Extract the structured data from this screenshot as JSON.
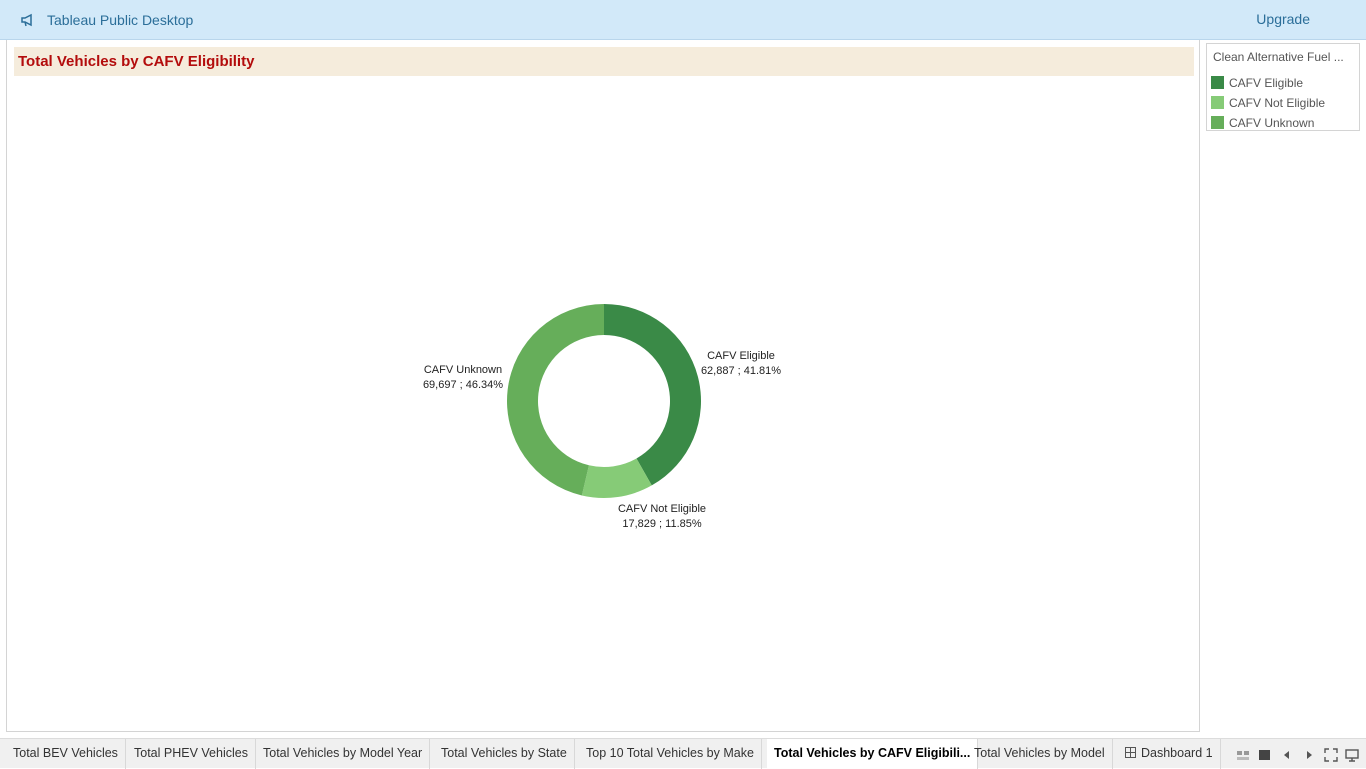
{
  "app": {
    "title": "Tableau Public Desktop",
    "upgrade_label": "Upgrade"
  },
  "sheet": {
    "title": "Total Vehicles by CAFV Eligibility"
  },
  "legend": {
    "title": "Clean Alternative Fuel ...",
    "items": [
      {
        "label": "CAFV Eligible",
        "color": "#3a8a47"
      },
      {
        "label": "CAFV Not Eligible",
        "color": "#86cb77"
      },
      {
        "label": "CAFV Unknown",
        "color": "#66ae5a"
      }
    ]
  },
  "chart_data": {
    "type": "pie",
    "title": "Total Vehicles by CAFV Eligibility",
    "slices": [
      {
        "category": "CAFV Eligible",
        "value": 62887,
        "percent": 41.81,
        "label": "62,887 ; 41.81%",
        "color": "#3a8a47"
      },
      {
        "category": "CAFV Not Eligible",
        "value": 17829,
        "percent": 11.85,
        "label": "17,829 ; 11.85%",
        "color": "#86cb77"
      },
      {
        "category": "CAFV Unknown",
        "value": 69697,
        "percent": 46.34,
        "label": "69,697 ; 46.34%",
        "color": "#66ae5a"
      }
    ]
  },
  "tabs": [
    {
      "label": "Total BEV Vehicles",
      "active": false
    },
    {
      "label": "Total PHEV Vehicles",
      "active": false
    },
    {
      "label": "Total Vehicles by Model Year",
      "active": false
    },
    {
      "label": "Total Vehicles by State",
      "active": false
    },
    {
      "label": "Top 10 Total Vehicles by Make",
      "active": false
    },
    {
      "label": "Total Vehicles by CAFV Eligibili...",
      "active": true
    },
    {
      "label": "Total Vehicles by Model",
      "active": false
    },
    {
      "label": "Dashboard 1",
      "active": false,
      "icon": "dashboard-icon"
    }
  ]
}
